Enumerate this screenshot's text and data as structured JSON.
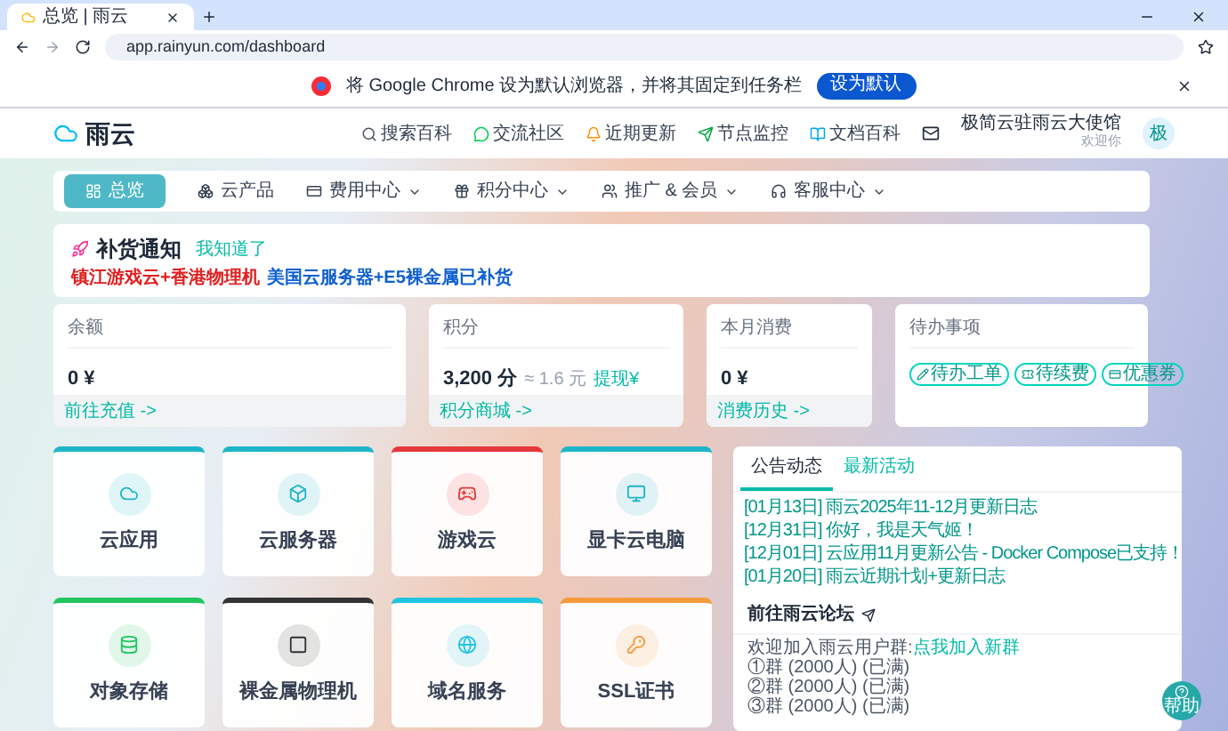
{
  "browser": {
    "tab_title": "总览 | 雨云",
    "url": "app.rainyun.com/dashboard"
  },
  "infobar": {
    "text": "将 Google Chrome 设为默认浏览器，并将其固定到任务栏",
    "button": "设为默认"
  },
  "header": {
    "logo": "雨云",
    "links": [
      "搜索百科",
      "交流社区",
      "近期更新",
      "节点监控",
      "文档百科"
    ],
    "user": {
      "name": "极简云驻雨云大使馆",
      "sub": "欢迎你",
      "avatar": "极"
    }
  },
  "nav": [
    {
      "label": "总览",
      "selected": true,
      "dropdown": false
    },
    {
      "label": "云产品",
      "selected": false,
      "dropdown": false
    },
    {
      "label": "费用中心",
      "selected": false,
      "dropdown": true
    },
    {
      "label": "积分中心",
      "selected": false,
      "dropdown": true
    },
    {
      "label": "推广 & 会员",
      "selected": false,
      "dropdown": true
    },
    {
      "label": "客服中心",
      "selected": false,
      "dropdown": true
    }
  ],
  "notice": {
    "title": "补货通知",
    "link": "我知道了",
    "segments": [
      {
        "text": "镇江游戏云+香港物理机",
        "color": "#e02020"
      },
      {
        "text": "美国云服务器+E5裸金属已补货",
        "color": "#1060d0"
      }
    ]
  },
  "stats": [
    {
      "title": "余额",
      "value": "0 ¥",
      "footer": "前往充值 ->"
    },
    {
      "title": "积分",
      "value": "3,200 分",
      "note": "≈ 1.6 元",
      "note_link": "提现¥",
      "footer": "积分商城 ->"
    },
    {
      "title": "本月消费",
      "value": "0 ¥",
      "footer": "消费历史 ->"
    }
  ],
  "todo": {
    "title": "待办事项",
    "buttons": [
      "待办工单",
      "待续费",
      "优惠券"
    ]
  },
  "products": [
    {
      "label": "云应用",
      "color": "#1fb5c8"
    },
    {
      "label": "云服务器",
      "color": "#1fb5c8"
    },
    {
      "label": "游戏云",
      "color": "#e5383b"
    },
    {
      "label": "显卡云电脑",
      "color": "#1fb5c8"
    },
    {
      "label": "对象存储",
      "color": "#22c55e"
    },
    {
      "label": "裸金属物理机",
      "color": "#333333"
    },
    {
      "label": "域名服务",
      "color": "#22c5e0"
    },
    {
      "label": "SSL证书",
      "color": "#f59a3c"
    }
  ],
  "announcements": {
    "tabs": [
      {
        "label": "公告动态",
        "selected": true
      },
      {
        "label": "最新活动",
        "selected": false
      }
    ],
    "items": [
      {
        "date": "[01月13日]",
        "text": "雨云2025年11-12月更新日志"
      },
      {
        "date": "[12月31日]",
        "text": "你好，我是天气姬！"
      },
      {
        "date": "[12月01日]",
        "text": "云应用11月更新公告 - Docker Compose已支持！"
      },
      {
        "date": "[01月20日]",
        "text": "雨云近期计划+更新日志"
      }
    ],
    "forum": {
      "title": "前往雨云论坛",
      "intro": "欢迎加入雨云用户群:",
      "link": "点我加入新群",
      "groups": [
        "①群 (2000人) (已满)",
        "②群 (2000人) (已满)",
        "③群 (2000人) (已满)"
      ]
    }
  },
  "help_button": "帮助"
}
